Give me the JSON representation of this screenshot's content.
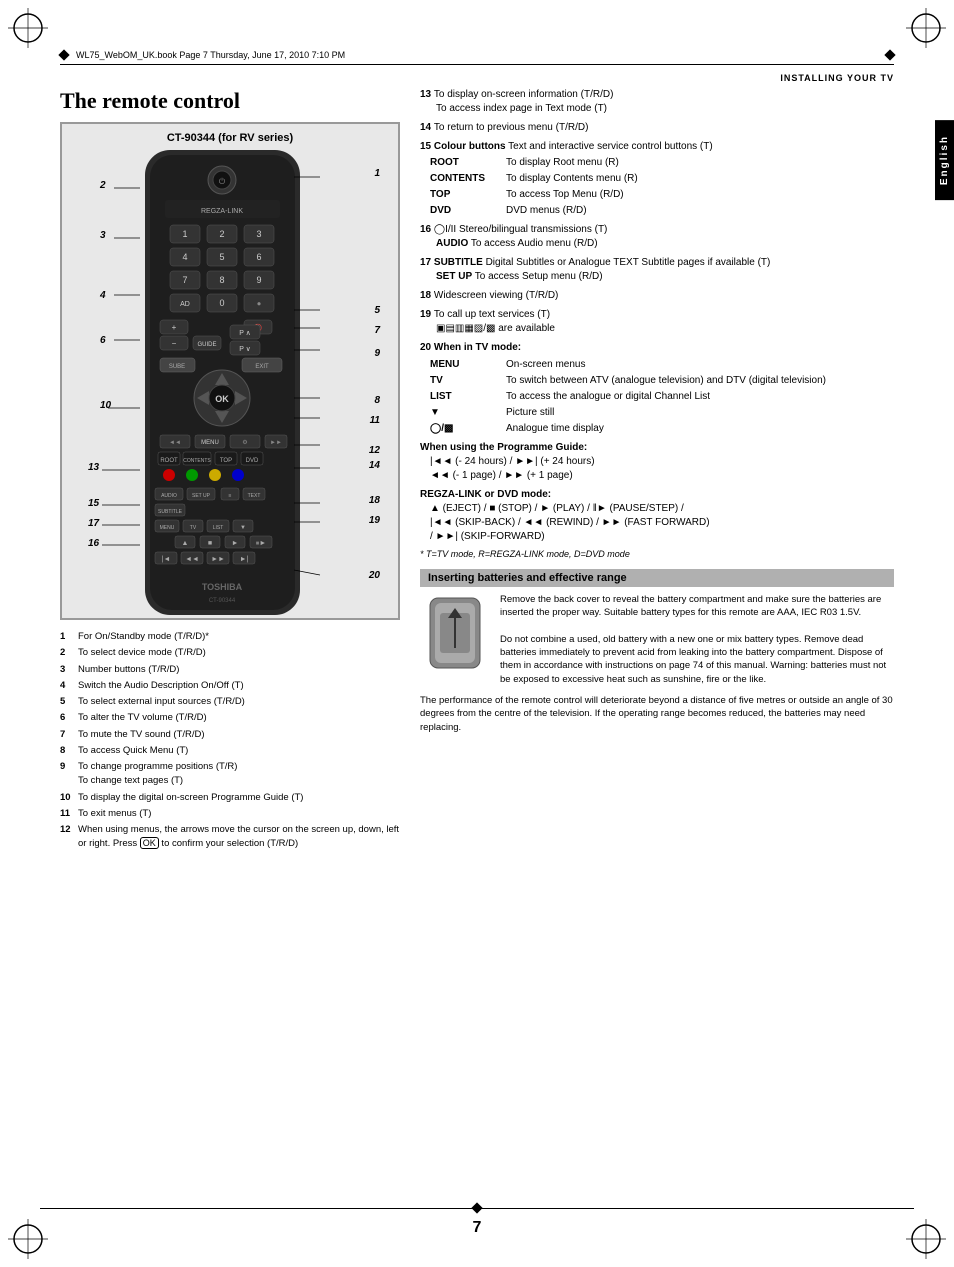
{
  "page": {
    "title": "The remote control",
    "remote_model": "CT-90344 (for RV series)",
    "section_header": "INSTALLING YOUR TV",
    "english_tab": "English",
    "header_text": "WL75_WebOM_UK.book  Page 7  Thursday, June 17, 2010  7:10 PM",
    "page_number": "7",
    "footnote": "* T=TV mode, R=REGZA-LINK mode, D=DVD mode"
  },
  "numbered_items_left": [
    {
      "num": "1",
      "text": "For On/Standby mode (T/R/D)*"
    },
    {
      "num": "2",
      "text": "To select device mode (T/R/D)"
    },
    {
      "num": "3",
      "text": "Number buttons (T/R/D)"
    },
    {
      "num": "4",
      "text": "Switch the Audio Description On/Off (T)"
    },
    {
      "num": "5",
      "text": "To select external input sources (T/R/D)"
    },
    {
      "num": "6",
      "text": "To alter the TV volume (T/R/D)"
    },
    {
      "num": "7",
      "text": "To mute the TV sound (T/R/D)"
    },
    {
      "num": "8",
      "text": "To access Quick Menu (T)"
    },
    {
      "num": "9",
      "text": "To change programme positions (T/R)\nTo change text pages (T)"
    },
    {
      "num": "10",
      "text": "To display the digital on-screen Programme Guide (T)"
    },
    {
      "num": "11",
      "text": "To exit menus (T)"
    },
    {
      "num": "12",
      "text": "When using menus, the arrows move the cursor on the screen up, down, left or right. Press OK to confirm your selection (T/R/D)"
    }
  ],
  "numbered_items_right": [
    {
      "num": "13",
      "text": "To display on-screen information (T/R/D)\nTo access index page in Text mode (T)"
    },
    {
      "num": "14",
      "text": "To return to previous menu (T/R/D)"
    },
    {
      "num": "15",
      "bold": "Colour buttons",
      "text": " Text and interactive service control buttons (T)"
    },
    {
      "num": "16",
      "text": "Stereo/bilingual transmissions (T)\nAUDIO To access Audio menu (R/D)"
    },
    {
      "num": "17",
      "bold": "SUBTITLE",
      "text": " Digital Subtitles or Analogue TEXT Subtitle pages if available (T)\nSET UP To access Setup menu (R/D)"
    },
    {
      "num": "18",
      "text": "Widescreen viewing (T/R/D)"
    },
    {
      "num": "19",
      "text": "To call up text services (T)\nare available"
    },
    {
      "num": "20",
      "bold": "When in TV mode:",
      "items": [
        {
          "key": "MENU",
          "val": "On-screen menus"
        },
        {
          "key": "TV",
          "val": "To switch between ATV (analogue television) and DTV (digital television)"
        },
        {
          "key": "LIST",
          "val": "To access the analogue or digital Channel List"
        },
        {
          "key": "▼",
          "val": "Picture still"
        },
        {
          "key": "⏱/→",
          "val": "Analogue time display"
        }
      ]
    }
  ],
  "colour_buttons": [
    {
      "key": "ROOT",
      "val": "To display Root menu (R)"
    },
    {
      "key": "CONTENTS",
      "val": "To display Contents menu (R)"
    },
    {
      "key": "TOP",
      "val": "To access Top Menu (R/D)"
    },
    {
      "key": "DVD",
      "val": "DVD menus (R/D)"
    }
  ],
  "programme_guide": {
    "title": "When using the Programme Guide:",
    "items": [
      "|◄◄ (- 24 hours) / ►►| (+ 24 hours)",
      "◄◄ (- 1 page) / ►► (+ 1 page)"
    ]
  },
  "regza_mode": {
    "title": "REGZA-LINK or DVD mode:",
    "text": "▲ (EJECT) / ■ (STOP) / ► (PLAY) / ‖► (PAUSE/STEP) / |◄◄ (SKIP-BACK) / ◄◄ (REWIND) / ►► (FAST FORWARD) / ►►| (SKIP-FORWARD)"
  },
  "battery_section": {
    "title": "Inserting batteries and effective range",
    "text1": "Remove the back cover to reveal the battery compartment and make sure the batteries are inserted the proper way. Suitable battery types for this remote are AAA, IEC R03 1.5V.",
    "text2": "Do not combine a used, old battery with a new one or mix battery types. Remove dead batteries immediately to prevent acid from leaking into the battery compartment. Dispose of them in accordance with instructions on page 74 of this manual. Warning: batteries must not be exposed to excessive heat such as sunshine, fire or the like.",
    "text3": "The performance of the remote control will deteriorate beyond a distance of five metres or outside an angle of 30 degrees from the centre of the television. If the operating range becomes reduced, the batteries may need replacing."
  }
}
